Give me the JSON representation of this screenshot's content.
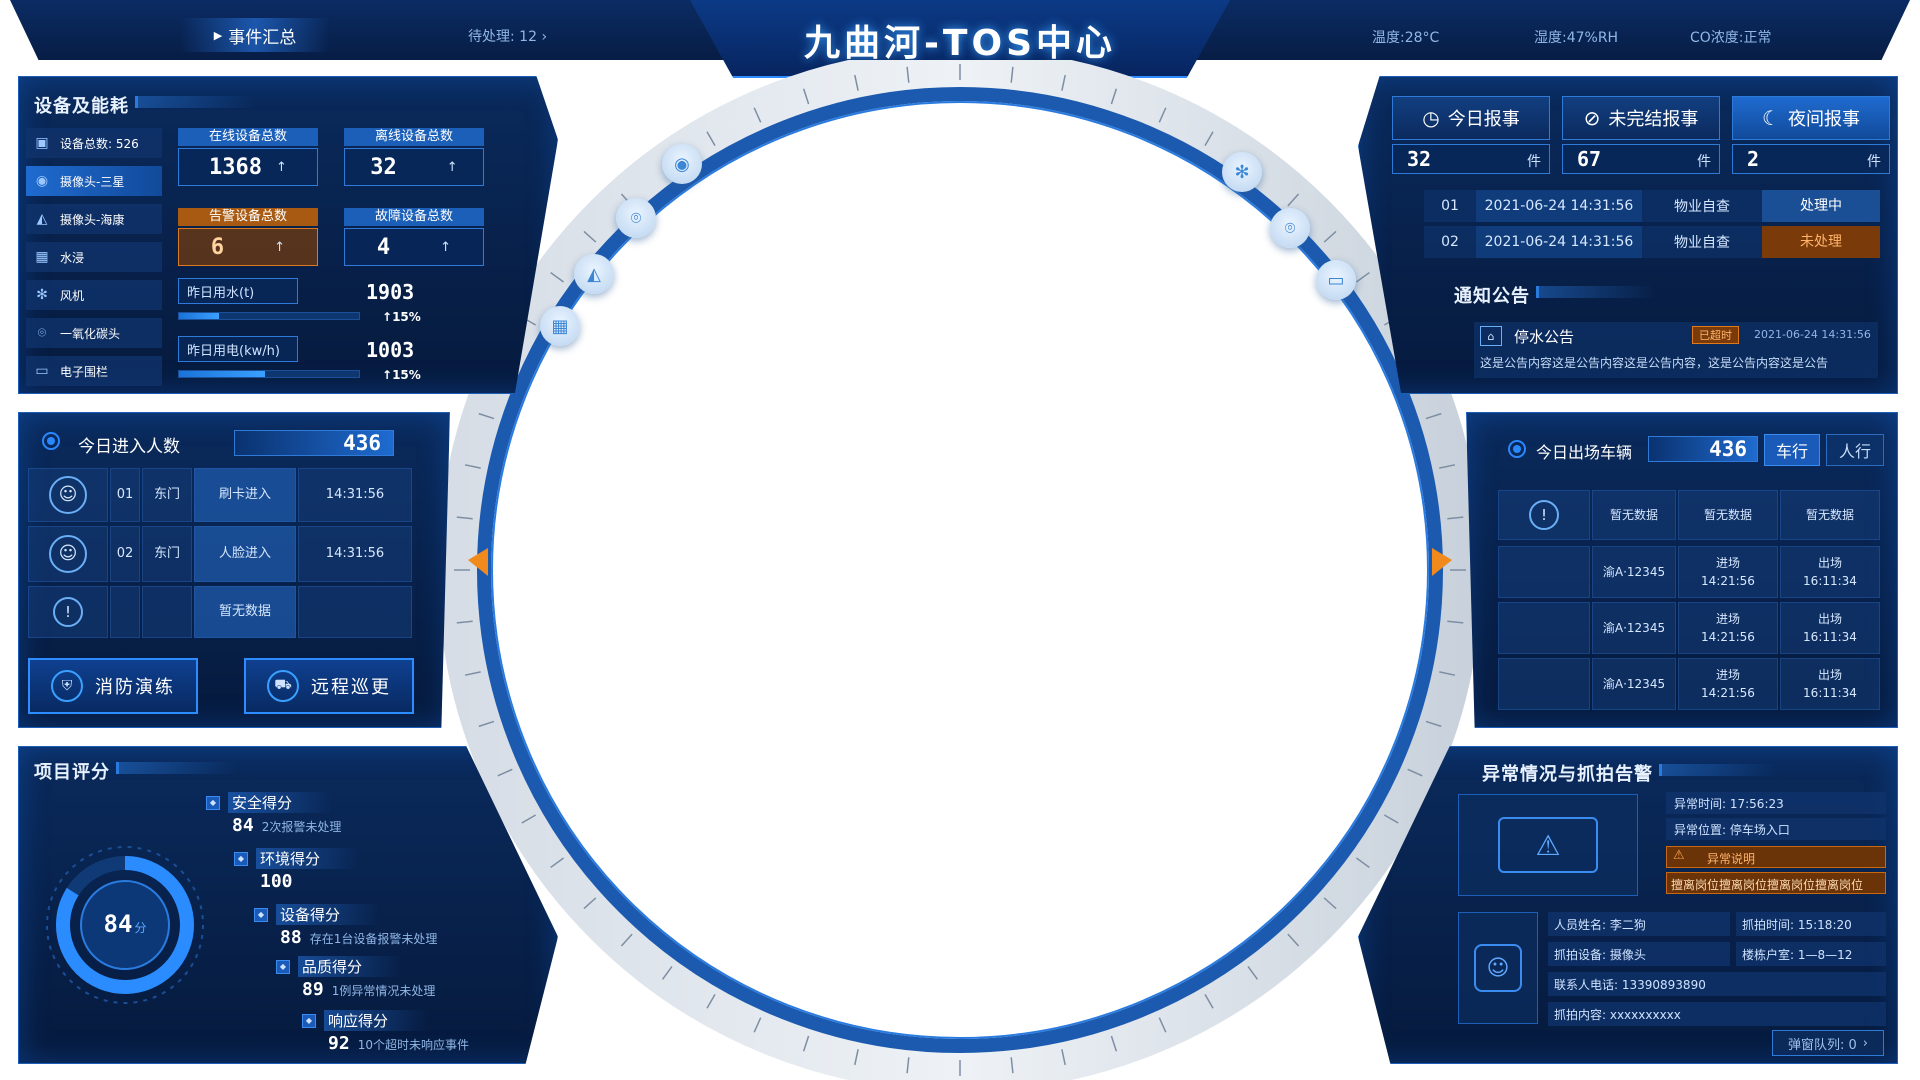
{
  "header": {
    "title": "九曲河-TOS中心",
    "events_tab": "事件汇总",
    "pending": "待处理: 12",
    "temp": "温度:28°C",
    "humidity": "湿度:47%RH",
    "co": "CO浓度:正常"
  },
  "devices": {
    "title": "设备及能耗",
    "side": [
      {
        "label": "设备总数: 526",
        "icon": "screen-icon"
      },
      {
        "label": "摄像头-三星",
        "icon": "camera-icon",
        "active": true
      },
      {
        "label": "摄像头-海康",
        "icon": "cctv-icon"
      },
      {
        "label": "水浸",
        "icon": "water-icon"
      },
      {
        "label": "风机",
        "icon": "fan-icon"
      },
      {
        "label": "一氧化碳头",
        "icon": "sensor-icon"
      },
      {
        "label": "电子围栏",
        "icon": "fence-icon"
      }
    ],
    "online": {
      "label": "在线设备总数",
      "value": "1368"
    },
    "offline": {
      "label": "离线设备总数",
      "value": "32"
    },
    "alarm": {
      "label": "告警设备总数",
      "value": "6"
    },
    "fault": {
      "label": "故障设备总数",
      "value": "4"
    },
    "water": {
      "label": "昨日用水(t)",
      "value": "1903",
      "change": "15%",
      "level": 0.22
    },
    "power": {
      "label": "昨日用电(kw/h)",
      "value": "1003",
      "change": "15%",
      "level": 0.48
    },
    "up_arrow": "↑"
  },
  "entry": {
    "title": "今日进入人数",
    "count": "436",
    "rows": [
      {
        "no": "01",
        "gate": "东门",
        "method": "刷卡进入",
        "time": "14:31:56"
      },
      {
        "no": "02",
        "gate": "东门",
        "method": "人脸进入",
        "time": "14:31:56"
      }
    ],
    "empty": "暂无数据",
    "btn_fire": "消防演练",
    "btn_patrol": "远程巡更"
  },
  "score": {
    "title": "项目评分",
    "total": "84",
    "unit": "分",
    "items": [
      {
        "name": "安全得分",
        "value": "84",
        "note": "2次报警未处理"
      },
      {
        "name": "环境得分",
        "value": "100",
        "note": ""
      },
      {
        "name": "设备得分",
        "value": "88",
        "note": "存在1台设备报警未处理"
      },
      {
        "name": "品质得分",
        "value": "89",
        "note": "1例异常情况未处理"
      },
      {
        "name": "响应得分",
        "value": "92",
        "note": "10个超时未响应事件"
      }
    ]
  },
  "reports": {
    "tabs": [
      {
        "label": "今日报事",
        "value": "32",
        "unit": "件",
        "icon": "clock-icon"
      },
      {
        "label": "未完结报事",
        "value": "67",
        "unit": "件",
        "icon": "ban-icon"
      },
      {
        "label": "夜间报事",
        "value": "2",
        "unit": "件",
        "icon": "moon-icon"
      }
    ],
    "rows": [
      {
        "no": "01",
        "time": "2021-06-24 14:31:56",
        "type": "物业自查",
        "status": "处理中"
      },
      {
        "no": "02",
        "time": "2021-06-24 14:31:56",
        "type": "物业自查",
        "status": "未处理"
      }
    ],
    "notice_title": "通知公告",
    "notice": {
      "name": "停水公告",
      "badge": "已超时",
      "time": "2021-06-24 14:31:56",
      "content": "这是公告内容这是公告内容这是公告内容，这是公告内容这是公告"
    }
  },
  "vehicles": {
    "title": "今日出场车辆",
    "count": "436",
    "tab_car": "车行",
    "tab_person": "人行",
    "empty": "暂无数据",
    "rows": [
      {
        "plate": "渝A·12345",
        "in": "进场",
        "in_time": "14:21:56",
        "out": "出场",
        "out_time": "16:11:34"
      },
      {
        "plate": "渝A·12345",
        "in": "进场",
        "in_time": "14:21:56",
        "out": "出场",
        "out_time": "16:11:34"
      },
      {
        "plate": "渝A·12345",
        "in": "进场",
        "in_time": "14:21:56",
        "out": "出场",
        "out_time": "16:11:34"
      }
    ]
  },
  "alert": {
    "title": "异常情况与抓拍告警",
    "time": "异常时间: 17:56:23",
    "location": "异常位置: 停车场入口",
    "desc_label": "异常说明",
    "desc": "擅离岗位擅离岗位擅离岗位擅离岗位",
    "name": "人员姓名: 李二狗",
    "capture_time": "抓拍时间: 15:18:20",
    "device": "抓拍设备: 摄像头",
    "building": "楼栋户室: 1—8—12",
    "phone": "联系人电话: 13390893890",
    "content": "抓拍内容: xxxxxxxxxx",
    "queue": "弹窗队列: 0"
  },
  "colors": {
    "accent": "#2d7ad8",
    "warn": "#e07a18",
    "bg": "#061a3d"
  }
}
